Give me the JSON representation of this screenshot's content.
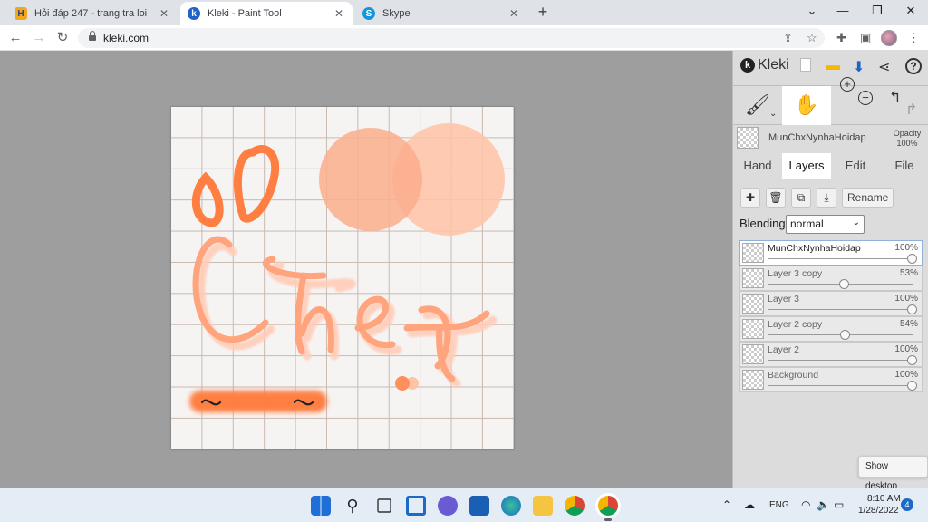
{
  "browser": {
    "tabs": [
      {
        "title": "Hỏi đáp 247 - trang tra loi",
        "favicon": "hoidap-favicon",
        "active": false
      },
      {
        "title": "Kleki - Paint Tool",
        "favicon": "kleki-favicon",
        "active": true
      },
      {
        "title": "Skype",
        "favicon": "skype-favicon",
        "active": false
      }
    ],
    "url": "kleki.com"
  },
  "app": {
    "logo_text": "Kleki",
    "current_layer_name": "MunChxNynhaHoidap",
    "opacity_label": "Opacity",
    "opacity_value": "100%",
    "panel_tabs": [
      "Hand",
      "Layers",
      "Edit",
      "File"
    ],
    "active_tab": "Layers",
    "rename_label": "Rename",
    "blending_label": "Blending",
    "blending_value": "normal",
    "layers": [
      {
        "name": "MunChxNynhaHoidap",
        "opacity": "100%",
        "opacity_fraction": 1.0,
        "selected": true
      },
      {
        "name": "Layer 3 copy",
        "opacity": "53%",
        "opacity_fraction": 0.53,
        "selected": false
      },
      {
        "name": "Layer 3",
        "opacity": "100%",
        "opacity_fraction": 1.0,
        "selected": false
      },
      {
        "name": "Layer 2 copy",
        "opacity": "54%",
        "opacity_fraction": 0.54,
        "selected": false
      },
      {
        "name": "Layer 2",
        "opacity": "100%",
        "opacity_fraction": 1.0,
        "selected": false
      },
      {
        "name": "Background",
        "opacity": "100%",
        "opacity_fraction": 1.0,
        "selected": false
      }
    ],
    "tooltip": "Show desktop",
    "accent_color": "#ff7f42"
  },
  "taskbar": {
    "lang": "ENG",
    "time": "8:10 AM",
    "date": "1/28/2022",
    "notifications": "4"
  }
}
